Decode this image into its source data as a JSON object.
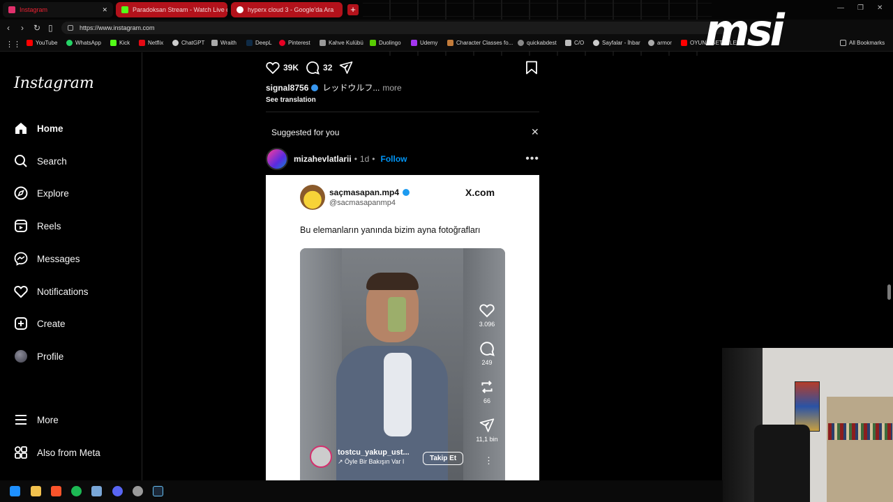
{
  "browser": {
    "tabs": [
      {
        "label": "Instagram",
        "state": "active",
        "favicon_color": "#e1306c"
      },
      {
        "label": "Paradoksan Stream - Watch Live on K",
        "state": "red",
        "favicon_color": "#53fc18"
      },
      {
        "label": "hyperx cloud 3 - Google'da Ara",
        "state": "red",
        "favicon_color": "#ffffff"
      }
    ],
    "url": "https://www.instagram.com",
    "bookmarks": [
      {
        "label": "YouTube",
        "color": "#ff0000"
      },
      {
        "label": "WhatsApp",
        "color": "#25d366"
      },
      {
        "label": "Kick",
        "color": "#53fc18"
      },
      {
        "label": "Netflix",
        "color": "#e50914"
      },
      {
        "label": "ChatGPT",
        "color": "#cccccc"
      },
      {
        "label": "Wraith",
        "color": "#aaaaaa"
      },
      {
        "label": "DeepL",
        "color": "#0f2b46"
      },
      {
        "label": "Pinterest",
        "color": "#e60023"
      },
      {
        "label": "Kahve Kulübü",
        "color": "#999999"
      },
      {
        "label": "Duolingo",
        "color": "#58cc02"
      },
      {
        "label": "Udemy",
        "color": "#a435f0"
      },
      {
        "label": "Character Classes fo...",
        "color": "#c27b3a"
      },
      {
        "label": "quickabdest",
        "color": "#888888"
      },
      {
        "label": "C/O",
        "color": "#bbbbbb"
      },
      {
        "label": "Sayfalar - İhbar",
        "color": "#cccccc"
      },
      {
        "label": "armor",
        "color": "#aaaaaa"
      },
      {
        "label": "OYUNA GETİRİLEN...",
        "color": "#ff0000"
      }
    ],
    "all_bookmarks": "All Bookmarks",
    "brand": "msi"
  },
  "sidebar": {
    "logo": "Instagram",
    "items": [
      {
        "label": "Home",
        "icon": "home-icon",
        "bold": true
      },
      {
        "label": "Search",
        "icon": "search-icon"
      },
      {
        "label": "Explore",
        "icon": "compass-icon"
      },
      {
        "label": "Reels",
        "icon": "reels-icon"
      },
      {
        "label": "Messages",
        "icon": "messenger-icon"
      },
      {
        "label": "Notifications",
        "icon": "heart-icon"
      },
      {
        "label": "Create",
        "icon": "plus-square-icon"
      },
      {
        "label": "Profile",
        "icon": "avatar"
      },
      {
        "label": "More",
        "icon": "hamburger-icon"
      },
      {
        "label": "Also from Meta",
        "icon": "meta-apps-icon"
      }
    ]
  },
  "prev_post": {
    "likes": "39K",
    "comments": "32",
    "username": "signal8756",
    "caption": "レッドウルフ...",
    "more": "more",
    "see_translation": "See translation"
  },
  "suggested": {
    "title": "Suggested for you",
    "user": "mizahevlatlarii",
    "dot": "•",
    "time": "1d",
    "follow": "Follow"
  },
  "tweet": {
    "name": "saçmasapan.mp4",
    "handle": "@sacmasapanmp4",
    "site": "X.com",
    "text": "Bu elemanların yanında bizim ayna fotoğrafları",
    "video": {
      "likes": "3.096",
      "comments": "249",
      "reposts": "66",
      "shares": "11,1 bin",
      "user": "tostcu_yakup_ust...",
      "song": "Öyle Bir Bakışın Var I",
      "follow": "Takip Et"
    }
  },
  "colors": {
    "accent": "#0095f6",
    "verified": "#3897f0",
    "tab_red": "#b3121b"
  }
}
